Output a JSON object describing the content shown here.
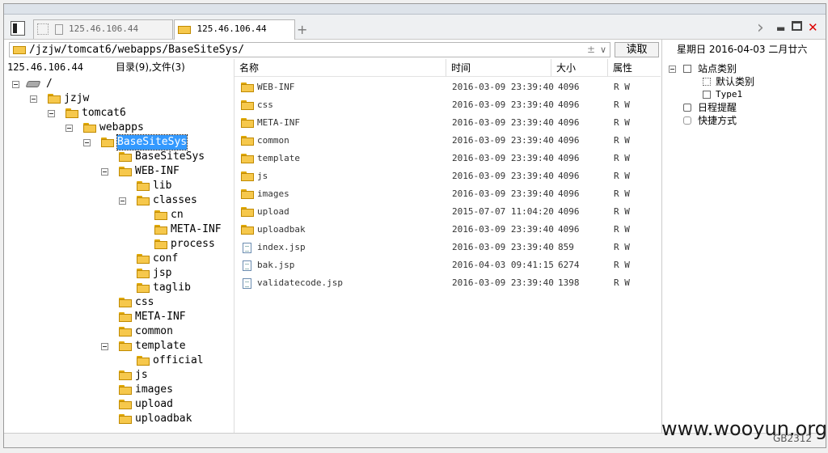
{
  "tabs": [
    {
      "label": "125.46.106.44"
    },
    {
      "label": "125.46.106.44"
    }
  ],
  "new_tab_symbol": "+",
  "nav_arrow": "›",
  "window_controls": {
    "minimize": "▬",
    "maximize": "□",
    "close": "✕"
  },
  "address": {
    "path": "/jzjw/tomcat6/webapps/BaseSiteSys/",
    "adjust_symbol": "±",
    "dropdown_symbol": "∨",
    "read_button": "读取"
  },
  "date_text": "星期日 2016-04-03 二月廿六",
  "left_status": {
    "ip": "125.46.106.44",
    "summary": "目录(9),文件(3)"
  },
  "tree": [
    {
      "label": "/",
      "depth": 0,
      "toggle": true,
      "icon": "drive"
    },
    {
      "label": "jzjw",
      "depth": 1,
      "toggle": true
    },
    {
      "label": "tomcat6",
      "depth": 2,
      "toggle": true
    },
    {
      "label": "webapps",
      "depth": 3,
      "toggle": true
    },
    {
      "label": "BaseSiteSys",
      "depth": 4,
      "toggle": true,
      "selected": true
    },
    {
      "label": "BaseSiteSys",
      "depth": 5,
      "toggle": false
    },
    {
      "label": "WEB-INF",
      "depth": 5,
      "toggle": true
    },
    {
      "label": "lib",
      "depth": 6,
      "toggle": false
    },
    {
      "label": "classes",
      "depth": 6,
      "toggle": true
    },
    {
      "label": "cn",
      "depth": 7,
      "toggle": false
    },
    {
      "label": "META-INF",
      "depth": 7,
      "toggle": false
    },
    {
      "label": "process",
      "depth": 7,
      "toggle": false
    },
    {
      "label": "conf",
      "depth": 6,
      "toggle": false
    },
    {
      "label": "jsp",
      "depth": 6,
      "toggle": false
    },
    {
      "label": "taglib",
      "depth": 6,
      "toggle": false
    },
    {
      "label": "css",
      "depth": 5,
      "toggle": false
    },
    {
      "label": "META-INF",
      "depth": 5,
      "toggle": false
    },
    {
      "label": "common",
      "depth": 5,
      "toggle": false
    },
    {
      "label": "template",
      "depth": 5,
      "toggle": true
    },
    {
      "label": "official",
      "depth": 6,
      "toggle": false
    },
    {
      "label": "js",
      "depth": 5,
      "toggle": false
    },
    {
      "label": "images",
      "depth": 5,
      "toggle": false
    },
    {
      "label": "upload",
      "depth": 5,
      "toggle": false
    },
    {
      "label": "uploadbak",
      "depth": 5,
      "toggle": false
    }
  ],
  "columns": {
    "name": "名称",
    "time": "时间",
    "size": "大小",
    "attr": "属性"
  },
  "files": [
    {
      "name": "WEB-INF",
      "time": "2016-03-09 23:39:40",
      "size": "4096",
      "attr": "R W",
      "type": "folder"
    },
    {
      "name": "css",
      "time": "2016-03-09 23:39:40",
      "size": "4096",
      "attr": "R W",
      "type": "folder"
    },
    {
      "name": "META-INF",
      "time": "2016-03-09 23:39:40",
      "size": "4096",
      "attr": "R W",
      "type": "folder"
    },
    {
      "name": "common",
      "time": "2016-03-09 23:39:40",
      "size": "4096",
      "attr": "R W",
      "type": "folder"
    },
    {
      "name": "template",
      "time": "2016-03-09 23:39:40",
      "size": "4096",
      "attr": "R W",
      "type": "folder"
    },
    {
      "name": "js",
      "time": "2016-03-09 23:39:40",
      "size": "4096",
      "attr": "R W",
      "type": "folder"
    },
    {
      "name": "images",
      "time": "2016-03-09 23:39:40",
      "size": "4096",
      "attr": "R W",
      "type": "folder"
    },
    {
      "name": "upload",
      "time": "2015-07-07 11:04:20",
      "size": "4096",
      "attr": "R W",
      "type": "folder"
    },
    {
      "name": "uploadbak",
      "time": "2016-03-09 23:39:40",
      "size": "4096",
      "attr": "R W",
      "type": "folder"
    },
    {
      "name": "index.jsp",
      "time": "2016-03-09 23:39:40",
      "size": "859",
      "attr": "R W",
      "type": "file"
    },
    {
      "name": "bak.jsp",
      "time": "2016-04-03 09:41:15",
      "size": "6274",
      "attr": "R W",
      "type": "file"
    },
    {
      "name": "validatecode.jsp",
      "time": "2016-03-09 23:39:40",
      "size": "1398",
      "attr": "R W",
      "type": "file"
    }
  ],
  "right_tree": {
    "site_category": "站点类别",
    "default_category": "默认类别",
    "type1": "Type1",
    "schedule": "日程提醒",
    "shortcuts": "快捷方式"
  },
  "watermark": "www.wooyun.org",
  "encoding": "GB2312"
}
